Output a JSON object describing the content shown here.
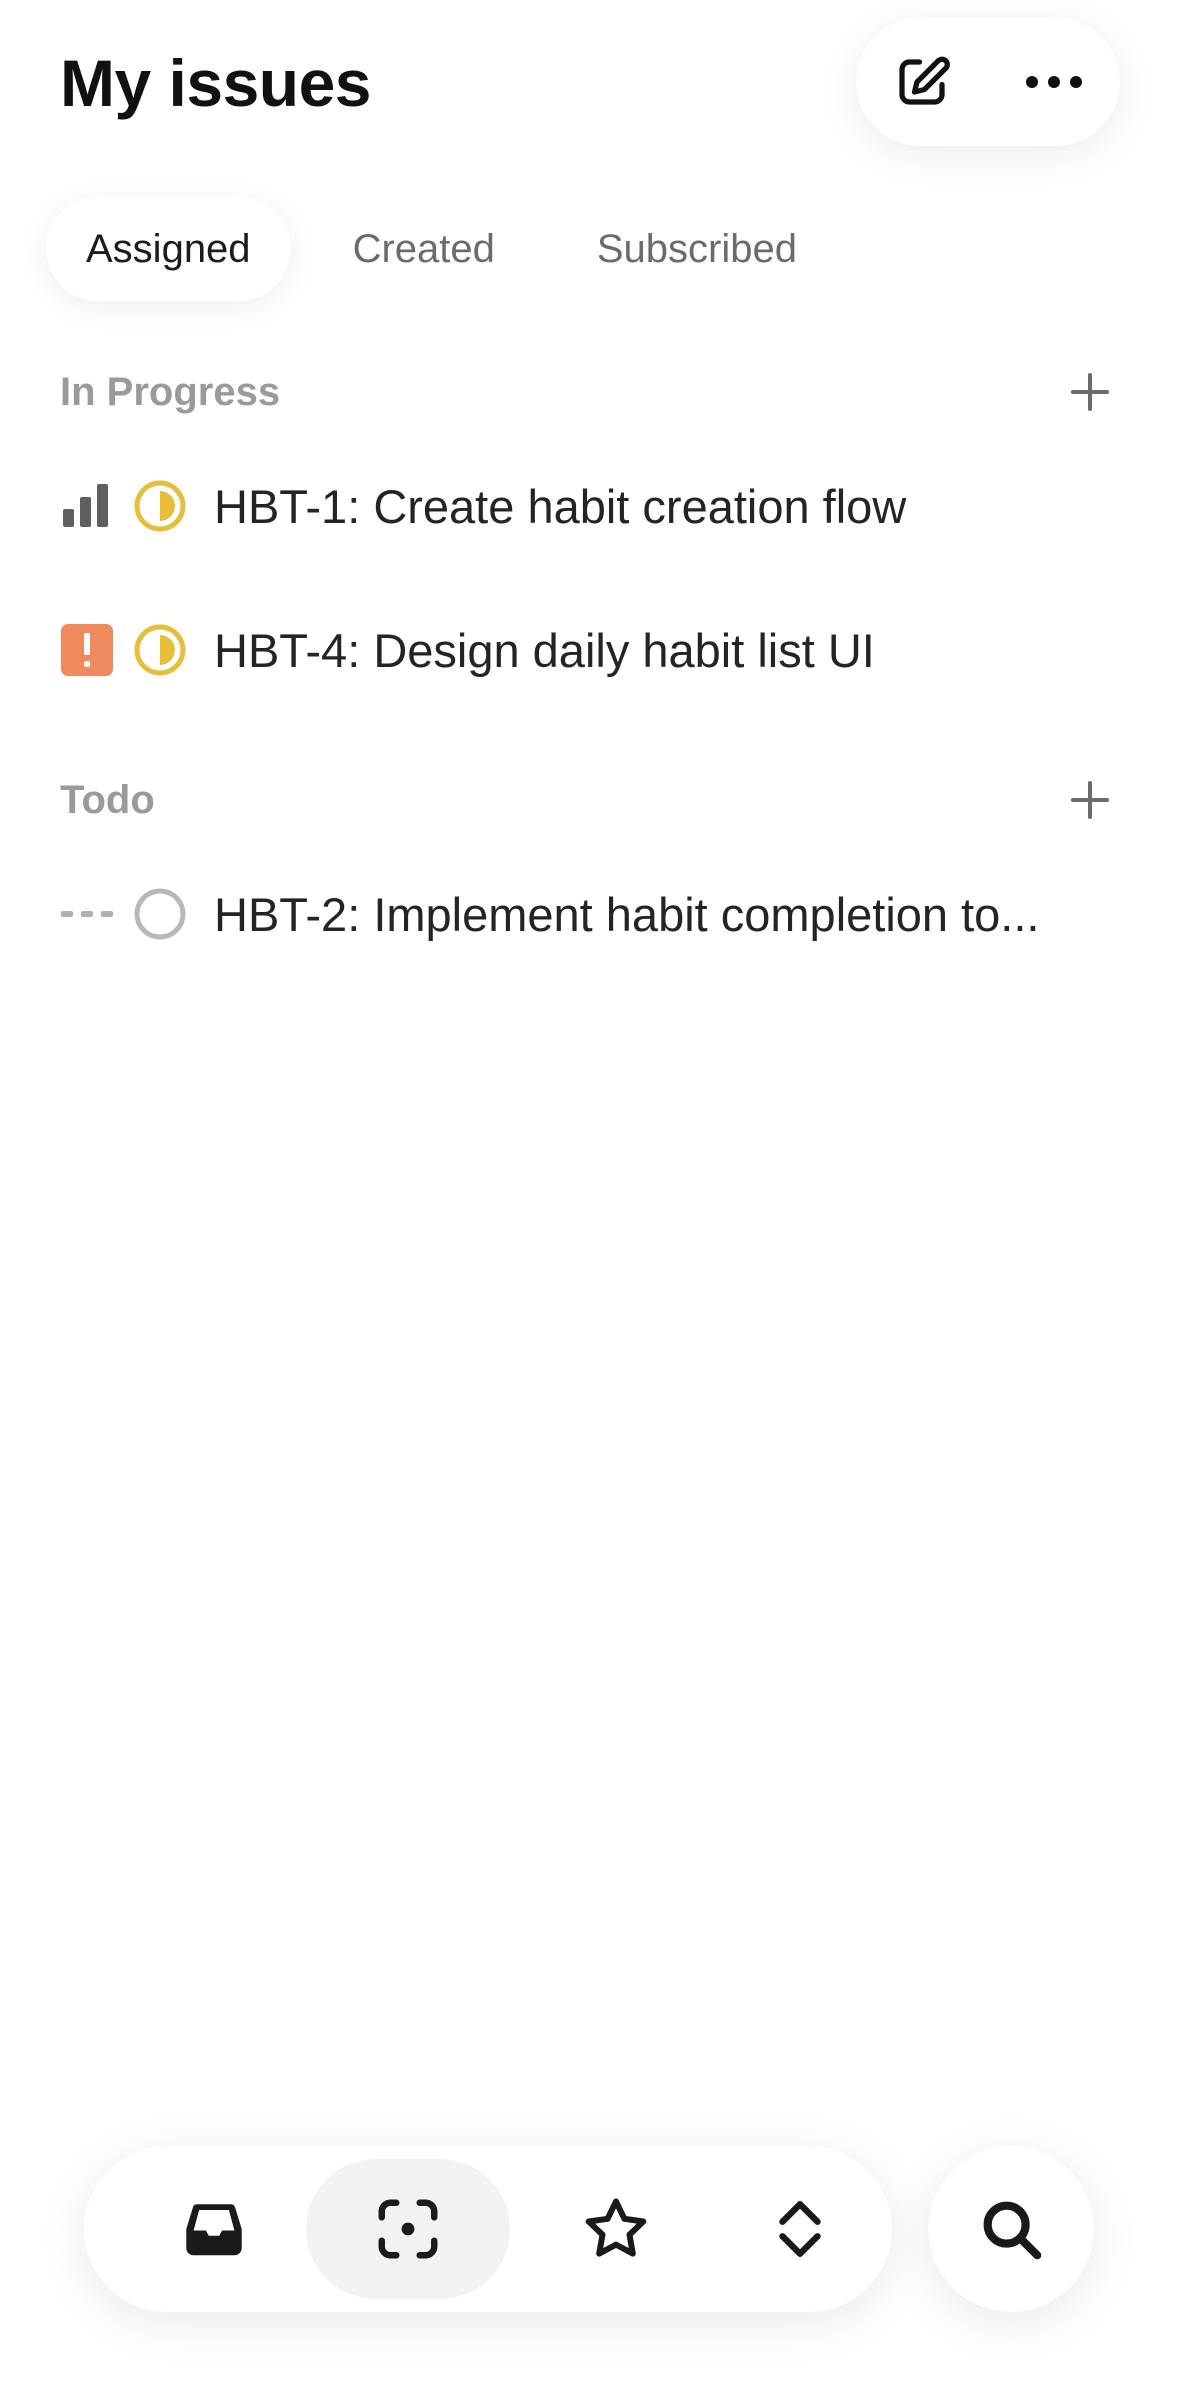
{
  "header": {
    "title": "My issues",
    "compose_icon": "compose-icon",
    "more_icon": "more-icon"
  },
  "tabs": [
    {
      "label": "Assigned",
      "active": true
    },
    {
      "label": "Created",
      "active": false
    },
    {
      "label": "Subscribed",
      "active": false
    }
  ],
  "sections": [
    {
      "title": "In Progress",
      "issues": [
        {
          "title": "HBT-1: Create habit creation flow",
          "priority": "high",
          "status": "in-progress"
        },
        {
          "title": "HBT-4: Design daily habit list UI",
          "priority": "urgent",
          "status": "in-progress"
        }
      ]
    },
    {
      "title": "Todo",
      "issues": [
        {
          "title": "HBT-2: Implement habit completion to...",
          "priority": "none",
          "status": "todo"
        }
      ]
    }
  ],
  "tabbar": {
    "items": [
      "inbox-icon",
      "focus-icon",
      "star-icon",
      "expand-icon"
    ],
    "selected": "focus-icon",
    "search": "search-icon"
  },
  "colors": {
    "in_progress": "#E6BE3C",
    "urgent": "#EE8A5E",
    "todo": "#B8B8B8",
    "section_title": "#9A9A9A"
  }
}
